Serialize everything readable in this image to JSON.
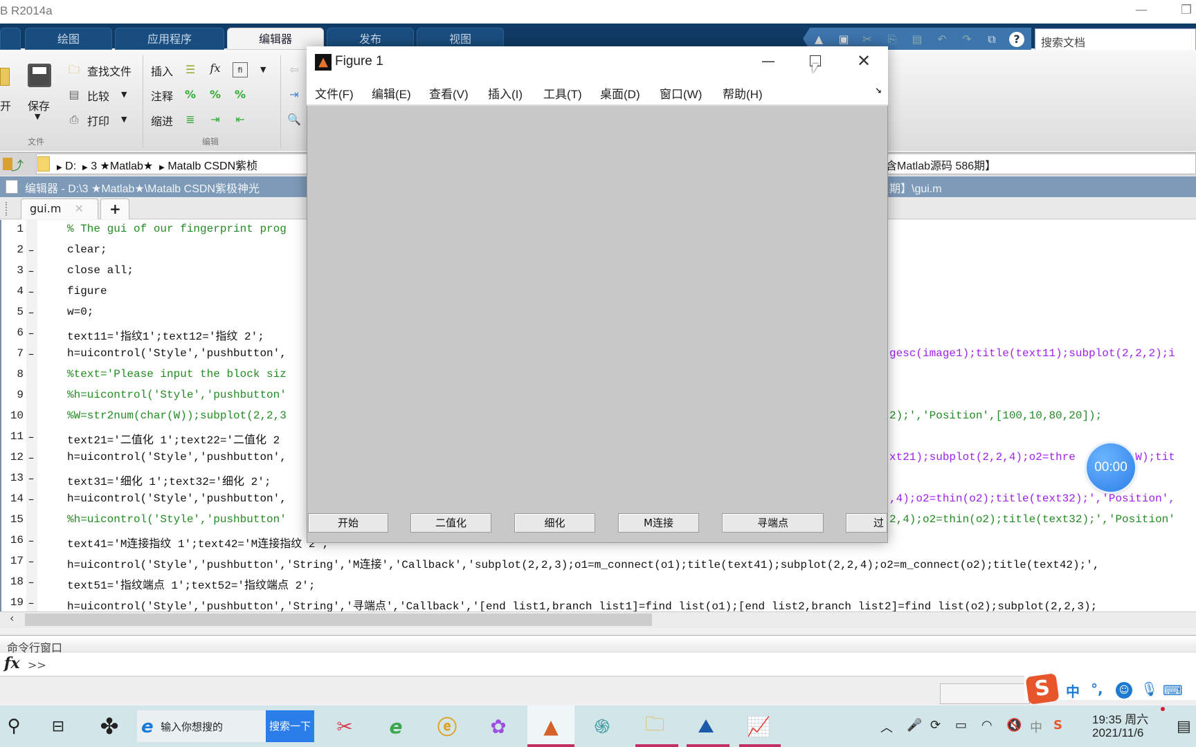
{
  "window": {
    "title": "B R2014a"
  },
  "tabs": [
    {
      "label": "绘图"
    },
    {
      "label": "应用程序"
    },
    {
      "label": "编辑器",
      "active": true
    },
    {
      "label": "发布"
    },
    {
      "label": "视图"
    }
  ],
  "search": {
    "placeholder": "搜索文档"
  },
  "ribbon": {
    "open_label": "开",
    "save_label": "保存",
    "find_files": "查找文件",
    "compare": "比较",
    "print": "打印",
    "insert": "插入",
    "comment": "注释",
    "indent": "缩进",
    "fx": "fx",
    "section_file": "文件",
    "section_edit": "编辑"
  },
  "address": {
    "segments": [
      "D:",
      "3 ★Matlab★",
      "Matalb CSDN紫桢"
    ],
    "tail": "含Matlab源码 586期】"
  },
  "editor": {
    "header_left": "编辑器 - D:\\3 ★Matlab★\\Matalb CSDN紫极神光",
    "header_right": "期】\\gui.m",
    "file_tab": "gui.m",
    "add_tab": "+"
  },
  "code": {
    "lines": [
      {
        "n": "1",
        "dash": "",
        "left": "% The gui of our fingerprint prog",
        "right": "",
        "lt": "cm"
      },
      {
        "n": "2",
        "dash": "–",
        "left": "clear;",
        "right": ""
      },
      {
        "n": "3",
        "dash": "–",
        "left": "close all;",
        "right": ""
      },
      {
        "n": "4",
        "dash": "–",
        "left": "figure",
        "right": ""
      },
      {
        "n": "5",
        "dash": "–",
        "left": "w=0;",
        "right": ""
      },
      {
        "n": "6",
        "dash": "–",
        "left": "text11='指纹1';text12='指纹 2';",
        "right": ""
      },
      {
        "n": "7",
        "dash": "–",
        "left": "h=uicontrol('Style','pushbutton',",
        "right": "gesc(image1);title(text11);subplot(2,2,2);i"
      },
      {
        "n": "8",
        "dash": "",
        "left": "%text='Please input the block siz",
        "right": "",
        "lt": "cm"
      },
      {
        "n": "9",
        "dash": "",
        "left": "%h=uicontrol('Style','pushbutton'",
        "right": "",
        "lt": "cm"
      },
      {
        "n": "10",
        "dash": "",
        "left": "%W=str2num(char(W));subplot(2,2,3",
        "right": "2);','Position',[100,10,80,20]);",
        "lt": "cm",
        "rt": "cm"
      },
      {
        "n": "11",
        "dash": "–",
        "left": "text21='二值化 1';text22='二值化 2",
        "right": ""
      },
      {
        "n": "12",
        "dash": "–",
        "left": "h=uicontrol('Style','pushbutton',",
        "right": "xt21);subplot(2,2,4);o2=thre      e2,W);tit"
      },
      {
        "n": "13",
        "dash": "–",
        "left": "text31='细化 1';text32='细化 2';",
        "right": ""
      },
      {
        "n": "14",
        "dash": "–",
        "left": "h=uicontrol('Style','pushbutton',",
        "right": ",4);o2=thin(o2);title(text32);','Position',"
      },
      {
        "n": "15",
        "dash": "",
        "left": "%h=uicontrol('Style','pushbutton'",
        "right": "2,4);o2=thin(o2);title(text32);','Position'",
        "lt": "cm",
        "rt": "cm"
      },
      {
        "n": "16",
        "dash": "–",
        "left": "text41='M连接指纹 1';text42='M连接指纹 2';",
        "right": ""
      },
      {
        "n": "17",
        "dash": "–",
        "left": "h=uicontrol('Style','pushbutton','String','M连接','Callback','subplot(2,2,3);o1=m_connect(o1);title(text41);subplot(2,2,4);o2=m_connect(o2);title(text42);',",
        "right": ""
      },
      {
        "n": "18",
        "dash": "–",
        "left": "text51='指纹端点 1';text52='指纹端点 2';",
        "right": ""
      },
      {
        "n": "19",
        "dash": "–",
        "left": "h=uicontrol('Style','pushbutton','String','寻端点','Callback','[end list1,branch list1]=find list(o1);[end list2,branch list2]=find list(o2);subplot(2,2,3);",
        "right": ""
      }
    ]
  },
  "command_window": {
    "title": "命令行窗口",
    "prompt": ">>",
    "fx": "fx"
  },
  "figure": {
    "title": "Figure 1",
    "menus": [
      "文件(F)",
      "编辑(E)",
      "查看(V)",
      "插入(I)",
      "工具(T)",
      "桌面(D)",
      "窗口(W)",
      "帮助(H)"
    ],
    "buttons": [
      "开始",
      "二值化",
      "细化",
      "M连接",
      "寻端点",
      "过"
    ]
  },
  "timer": {
    "text": "00:00"
  },
  "taskbar": {
    "search_placeholder": "输入你想搜的",
    "search_button": "搜索一下",
    "time": "19:35 周六",
    "date": "2021/11/6"
  },
  "ime": {
    "lang": "中",
    "punct": "°,"
  }
}
